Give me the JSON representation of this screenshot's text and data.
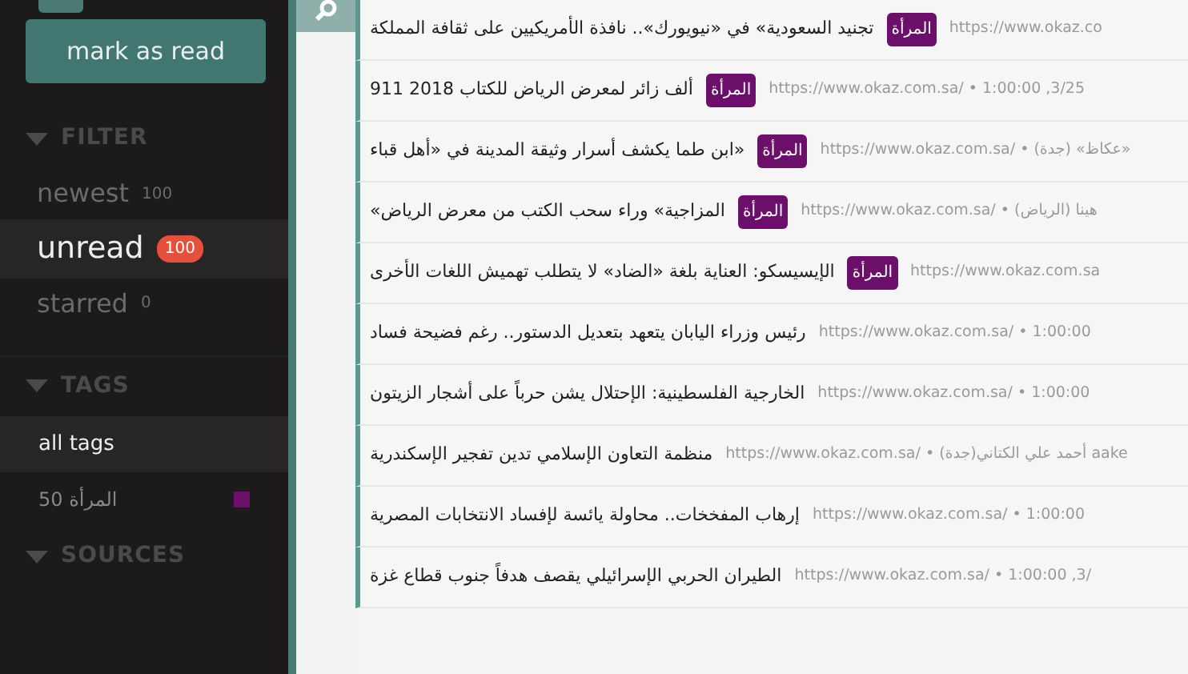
{
  "sidebar": {
    "mark_as_read": "mark as read",
    "filter": {
      "title": "FILTER",
      "expanded": true,
      "items": [
        {
          "label": "newest",
          "count": "100",
          "selected": false
        },
        {
          "label": "unread",
          "count": "100",
          "selected": true
        },
        {
          "label": "starred",
          "count": "0",
          "selected": false
        }
      ]
    },
    "tags": {
      "title": "TAGS",
      "expanded": true,
      "items": [
        {
          "label": "all tags",
          "selected": true
        },
        {
          "label": "المرأة",
          "count": "50",
          "color": "#6b0f6b",
          "selected": false
        }
      ]
    },
    "sources": {
      "title": "SOURCES",
      "expanded": true
    }
  },
  "items": [
    {
      "title": "تجنيد السعودية» في «نيويورك».. نافذة الأمريكيين على ثقافة المملكة",
      "tag": "المرأة",
      "meta": "https://www.okaz.co"
    },
    {
      "title": "ألف زائر لمعرض الرياض للكتاب 2018 911",
      "tag": "المرأة",
      "meta": "https://www.okaz.com.sa/ • 1:00:00 ,3/25"
    },
    {
      "title": "«ابن طما يكشف أسرار وثيقة المدينة في «أهل قباء",
      "tag": "المرأة",
      "meta": "https://www.okaz.com.sa/ • عكاظ» (جدة)»"
    },
    {
      "title": "المزاجية» وراء سحب الكتب من معرض الرياض»",
      "tag": "المرأة",
      "meta": "https://www.okaz.com.sa/ • هينا (الرياض)"
    },
    {
      "title": "الإيسيسكو: العناية بلغة «الضاد» لا يتطلب تهميش اللغات الأخرى",
      "tag": "المرأة",
      "meta": "https://www.okaz.com.sa"
    },
    {
      "title": "رئيس وزراء اليابان يتعهد بتعديل الدستور.. رغم فضيحة فساد",
      "meta": "https://www.okaz.com.sa/ • 1:00:00"
    },
    {
      "title": "الخارجية الفلسطينية: الإحتلال يشن حرباً على أشجار الزيتون",
      "meta": "https://www.okaz.com.sa/ • 1:00:00"
    },
    {
      "title": "منظمة التعاون الإسلامي تدين تفجير الإسكندرية",
      "meta": "https://www.okaz.com.sa/ • أحمد علي الكتاني(جدة) aake"
    },
    {
      "title": "إرهاب المفخخات.. محاولة يائسة لإفساد الانتخابات المصرية",
      "meta": "https://www.okaz.com.sa/ • 1:00:00"
    },
    {
      "title": "الطيران الحربي الإسرائيلي يقصف هدفاً جنوب قطاع غزة",
      "meta": "https://www.okaz.com.sa/ • 1:00:00 ,3/"
    }
  ]
}
